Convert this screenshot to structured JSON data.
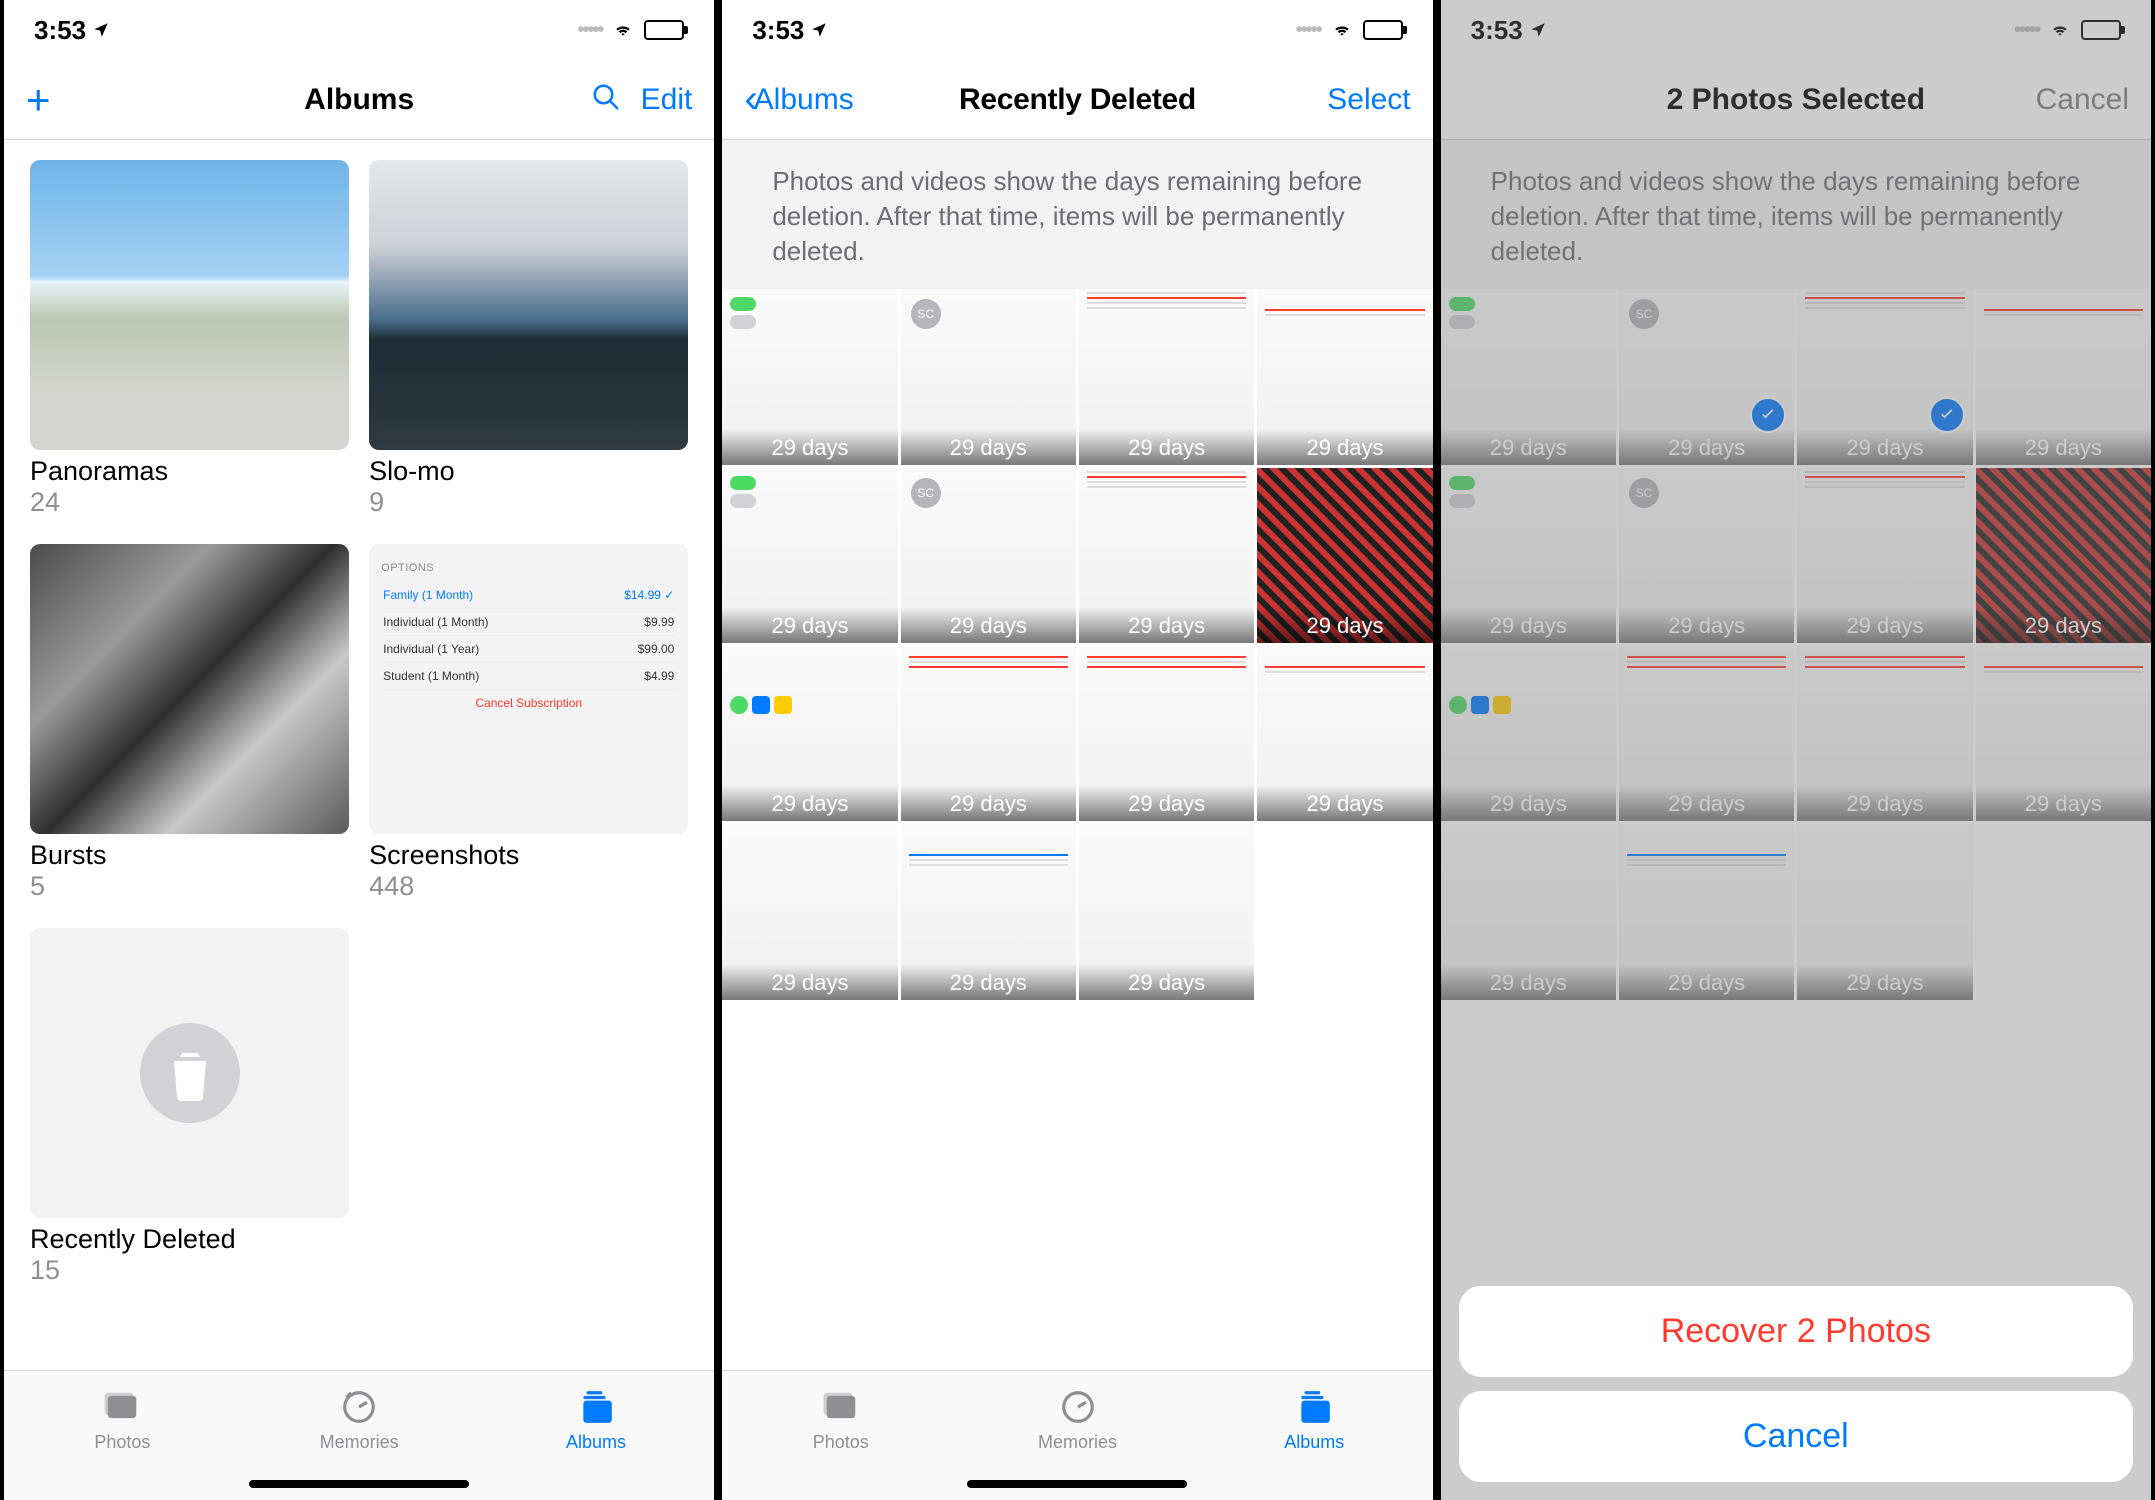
{
  "status": {
    "time": "3:53",
    "location_active": true
  },
  "screen1": {
    "title": "Albums",
    "edit_label": "Edit",
    "tabs": {
      "photos": "Photos",
      "memories": "Memories",
      "albums": "Albums"
    },
    "albums": [
      {
        "name": "Panoramas",
        "count": "24"
      },
      {
        "name": "Slo-mo",
        "count": "9"
      },
      {
        "name": "Bursts",
        "count": "5"
      },
      {
        "name": "Screenshots",
        "count": "448"
      },
      {
        "name": "Recently Deleted",
        "count": "15"
      }
    ],
    "options_list": {
      "header": "OPTIONS",
      "rows": [
        {
          "label": "Family (1 Month)",
          "price": "$14.99",
          "selected": true
        },
        {
          "label": "Individual (1 Month)",
          "price": "$9.99",
          "selected": false
        },
        {
          "label": "Individual (1 Year)",
          "price": "$99.00",
          "selected": false
        },
        {
          "label": "Student (1 Month)",
          "price": "$4.99",
          "selected": false
        }
      ],
      "cancel": "Cancel Subscription"
    }
  },
  "screen2": {
    "back_label": "Albums",
    "title": "Recently Deleted",
    "select_label": "Select",
    "description": "Photos and videos show the days remaining before deletion. After that time, items will be permanently deleted.",
    "day_label": "29 days",
    "tabs": {
      "photos": "Photos",
      "memories": "Memories",
      "albums": "Albums"
    },
    "grid_count": 15
  },
  "screen3": {
    "title": "2 Photos Selected",
    "cancel_label": "Cancel",
    "description": "Photos and videos show the days remaining before deletion. After that time, items will be permanently deleted.",
    "day_label": "29 days",
    "action_sheet": {
      "recover": "Recover 2 Photos",
      "cancel": "Cancel"
    },
    "selected_indices": [
      1,
      2
    ]
  }
}
